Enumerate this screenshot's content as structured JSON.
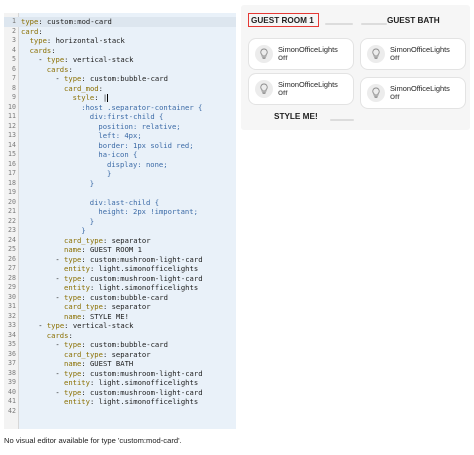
{
  "editor": {
    "lines": [
      {
        "n": "1",
        "i": 0,
        "k": "type",
        "s": ": ",
        "v": "custom:mod-card"
      },
      {
        "n": "2",
        "i": 0,
        "k": "card",
        "s": ":",
        "v": ""
      },
      {
        "n": "3",
        "i": 1,
        "k": "type",
        "s": ": ",
        "v": "horizontal-stack"
      },
      {
        "n": "4",
        "i": 1,
        "k": "cards",
        "s": ":",
        "v": ""
      },
      {
        "n": "5",
        "i": 2,
        "d": "- ",
        "k": "type",
        "s": ": ",
        "v": "vertical-stack"
      },
      {
        "n": "6",
        "i": 3,
        "k": "cards",
        "s": ":",
        "v": ""
      },
      {
        "n": "7",
        "i": 4,
        "d": "- ",
        "k": "type",
        "s": ": ",
        "v": "custom:bubble-card"
      },
      {
        "n": "8",
        "i": 5,
        "k": "card_mod",
        "s": ":",
        "v": ""
      },
      {
        "n": "9",
        "i": 6,
        "k": "style",
        "s": ": ",
        "v": "|",
        "cursor": true
      },
      {
        "n": "10",
        "i": 7,
        "c": ":host .separator-container {"
      },
      {
        "n": "11",
        "i": 8,
        "c": "div:first-child {"
      },
      {
        "n": "12",
        "i": 9,
        "c": "position: relative;"
      },
      {
        "n": "13",
        "i": 9,
        "c": "left: 4px;"
      },
      {
        "n": "14",
        "i": 9,
        "c": "border: 1px solid red;"
      },
      {
        "n": "15",
        "i": 9,
        "c": "ha-icon {"
      },
      {
        "n": "16",
        "i": 10,
        "c": "display: none;"
      },
      {
        "n": "17",
        "i": 10,
        "c": "}"
      },
      {
        "n": "18",
        "i": 8,
        "c": "}"
      },
      {
        "n": "19",
        "i": 0,
        "c": ""
      },
      {
        "n": "20",
        "i": 8,
        "c": "div:last-child {"
      },
      {
        "n": "21",
        "i": 9,
        "c": "height: 2px !important;"
      },
      {
        "n": "22",
        "i": 8,
        "c": "}"
      },
      {
        "n": "23",
        "i": 7,
        "c": "}"
      },
      {
        "n": "24",
        "i": 5,
        "k": "card_type",
        "s": ": ",
        "v": "separator"
      },
      {
        "n": "25",
        "i": 5,
        "k": "name",
        "s": ": ",
        "v": "GUEST ROOM 1"
      },
      {
        "n": "26",
        "i": 4,
        "d": "- ",
        "k": "type",
        "s": ": ",
        "v": "custom:mushroom-light-card"
      },
      {
        "n": "27",
        "i": 5,
        "k": "entity",
        "s": ": ",
        "v": "light.simonofficelights"
      },
      {
        "n": "28",
        "i": 4,
        "d": "- ",
        "k": "type",
        "s": ": ",
        "v": "custom:mushroom-light-card"
      },
      {
        "n": "29",
        "i": 5,
        "k": "entity",
        "s": ": ",
        "v": "light.simonofficelights"
      },
      {
        "n": "30",
        "i": 4,
        "d": "- ",
        "k": "type",
        "s": ": ",
        "v": "custom:bubble-card"
      },
      {
        "n": "31",
        "i": 5,
        "k": "card_type",
        "s": ": ",
        "v": "separator"
      },
      {
        "n": "32",
        "i": 5,
        "k": "name",
        "s": ": ",
        "v": "STYLE ME!"
      },
      {
        "n": "33",
        "i": 2,
        "d": "- ",
        "k": "type",
        "s": ": ",
        "v": "vertical-stack"
      },
      {
        "n": "34",
        "i": 3,
        "k": "cards",
        "s": ":",
        "v": ""
      },
      {
        "n": "35",
        "i": 4,
        "d": "- ",
        "k": "type",
        "s": ": ",
        "v": "custom:bubble-card"
      },
      {
        "n": "36",
        "i": 5,
        "k": "card_type",
        "s": ": ",
        "v": "separator"
      },
      {
        "n": "37",
        "i": 5,
        "k": "name",
        "s": ": ",
        "v": "GUEST BATH"
      },
      {
        "n": "38",
        "i": 4,
        "d": "- ",
        "k": "type",
        "s": ": ",
        "v": "custom:mushroom-light-card"
      },
      {
        "n": "39",
        "i": 5,
        "k": "entity",
        "s": ": ",
        "v": "light.simonofficelights"
      },
      {
        "n": "40",
        "i": 4,
        "d": "- ",
        "k": "type",
        "s": ": ",
        "v": "custom:mushroom-light-card"
      },
      {
        "n": "41",
        "i": 5,
        "k": "entity",
        "s": ": ",
        "v": "light.simonofficelights"
      },
      {
        "n": "42",
        "i": 0,
        "c": ""
      }
    ]
  },
  "preview": {
    "separators": {
      "guest_room": "GUEST ROOM 1",
      "guest_bath": "GUEST BATH",
      "style_me": "STYLE ME!"
    },
    "tiles": [
      {
        "name": "SimonOfficeLights",
        "state": "Off"
      },
      {
        "name": "SimonOfficeLights",
        "state": "Off"
      },
      {
        "name": "SimonOfficeLights",
        "state": "Off"
      },
      {
        "name": "SimonOfficeLights",
        "state": "Off"
      }
    ],
    "colors": {
      "highlight_border": "#e53935",
      "key": "#8a6f00",
      "selector": "#3b6aa6"
    }
  },
  "footer": {
    "message": "No visual editor available for type 'custom:mod-card'."
  }
}
